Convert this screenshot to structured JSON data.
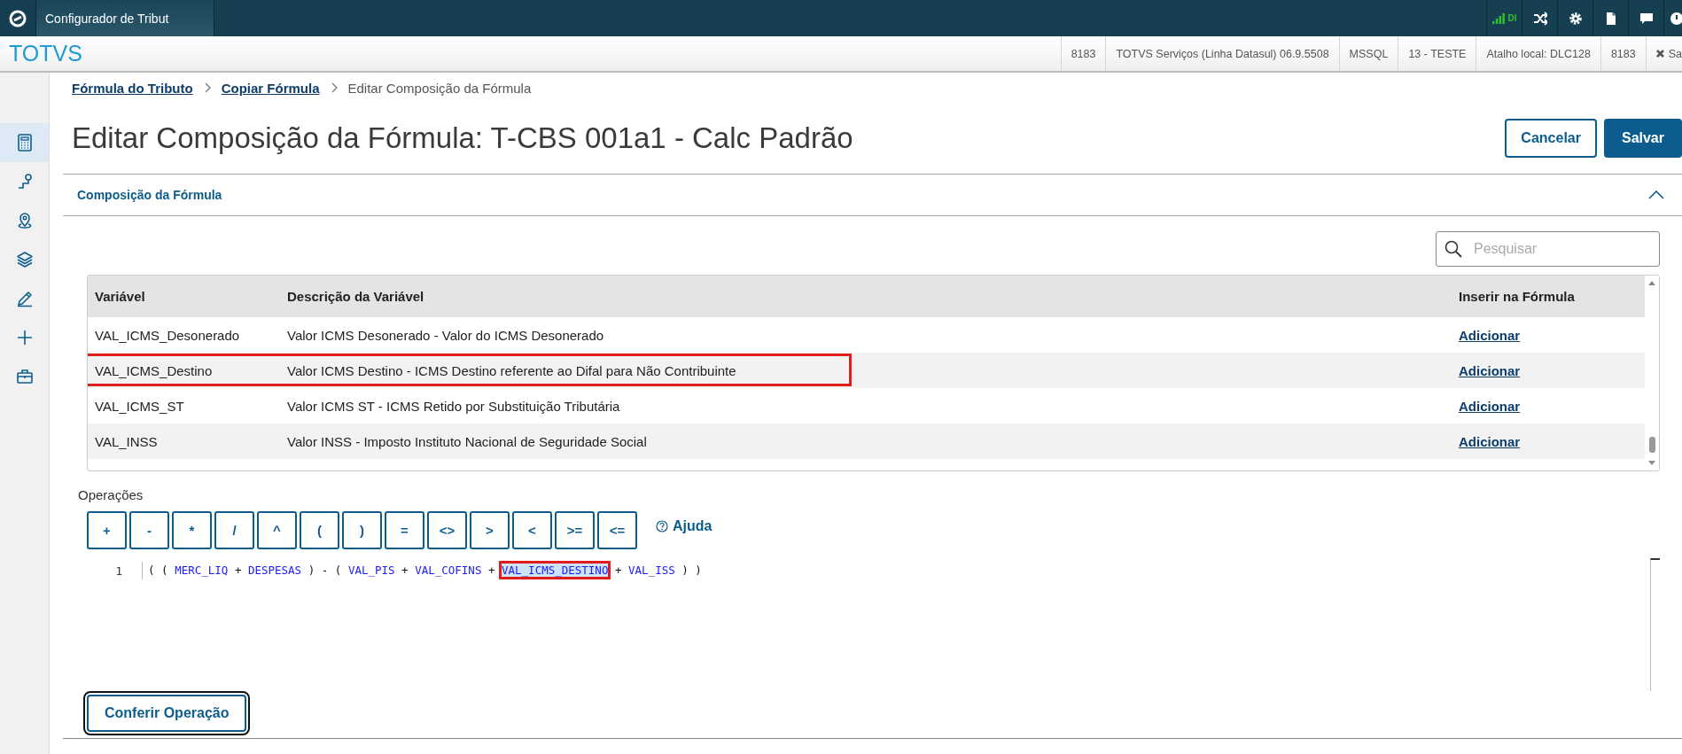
{
  "app_bar": {
    "tabs": [
      {
        "label": "Configurador de Tribut",
        "selected": true
      }
    ],
    "signal_label": "DI"
  },
  "header": {
    "brand": "TOTVS",
    "info": [
      "8183",
      "TOTVS Serviços (Linha Datasul) 06.9.5508",
      "MSSQL",
      "13 - TESTE",
      "Atalho local: DLC128",
      "8183"
    ],
    "exit_label": "Sa"
  },
  "sidebar": {
    "items": [
      {
        "kind": "calculator",
        "selected": true
      },
      {
        "kind": "route",
        "selected": false
      },
      {
        "kind": "pin",
        "selected": false
      },
      {
        "kind": "layers",
        "selected": false
      },
      {
        "kind": "pencil",
        "selected": false
      },
      {
        "kind": "plus",
        "selected": false
      },
      {
        "kind": "briefcase",
        "selected": false
      }
    ]
  },
  "breadcrumb": [
    {
      "label": "Fórmula do Tributo",
      "kind": "link"
    },
    {
      "label": "Copiar Fórmula",
      "kind": "link"
    },
    {
      "label": "Editar Composição da Fórmula",
      "kind": "current"
    }
  ],
  "title": "Editar Composição da Fórmula: T-CBS 001a1 - Calc Padrão",
  "actions": [
    {
      "label": "Cancelar",
      "kind": "secondary"
    },
    {
      "label": "Salvar",
      "kind": "primary"
    }
  ],
  "section": {
    "title": "Composição da Fórmula",
    "expanded": true
  },
  "search": {
    "placeholder": "Pesquisar"
  },
  "table": {
    "columns": [
      "Variável",
      "Descrição da Variável",
      "Inserir na Fórmula"
    ],
    "rows": [
      {
        "variable": "VAL_ICMS_Desonerado",
        "description": "Valor ICMS Desonerado - Valor do ICMS Desonerado",
        "action": "Adicionar",
        "highlighted": false
      },
      {
        "variable": "VAL_ICMS_Destino",
        "description": "Valor ICMS Destino - ICMS Destino referente ao Difal para Não Contribuinte",
        "action": "Adicionar",
        "highlighted": true
      },
      {
        "variable": "VAL_ICMS_ST",
        "description": "Valor ICMS ST - ICMS Retido por Substituição Tributária",
        "action": "Adicionar",
        "highlighted": false
      },
      {
        "variable": "VAL_INSS",
        "description": "Valor INSS - Imposto Instituto Nacional de Seguridade Social",
        "action": "Adicionar",
        "highlighted": false
      }
    ]
  },
  "operations": {
    "label": "Operações",
    "buttons": [
      "+",
      "-",
      "*",
      "/",
      "^",
      "(",
      ")",
      "=",
      "<>",
      ">",
      "<",
      ">=",
      "<="
    ],
    "help": "Ajuda"
  },
  "editor": {
    "lines": [
      {
        "number": "1",
        "tokens": [
          {
            "text": "(",
            "kind": "op",
            "highlighted": false
          },
          {
            "text": "(",
            "kind": "op",
            "highlighted": false
          },
          {
            "text": "MERC_LIQ",
            "kind": "var",
            "highlighted": false
          },
          {
            "text": "+",
            "kind": "op",
            "highlighted": false
          },
          {
            "text": "DESPESAS",
            "kind": "var",
            "highlighted": false
          },
          {
            "text": ")",
            "kind": "op",
            "highlighted": false
          },
          {
            "text": "-",
            "kind": "op",
            "highlighted": false
          },
          {
            "text": "(",
            "kind": "op",
            "highlighted": false
          },
          {
            "text": "VAL_PIS",
            "kind": "var",
            "highlighted": false
          },
          {
            "text": "+",
            "kind": "op",
            "highlighted": false
          },
          {
            "text": "VAL_COFINS",
            "kind": "var",
            "highlighted": false
          },
          {
            "text": "+",
            "kind": "op",
            "highlighted": false
          },
          {
            "text": "VAL_ICMS_DESTINO",
            "kind": "var",
            "highlighted": true
          },
          {
            "text": "+",
            "kind": "op",
            "highlighted": false
          },
          {
            "text": "VAL_ISS",
            "kind": "var",
            "highlighted": false
          },
          {
            "text": ")",
            "kind": "op",
            "highlighted": false
          },
          {
            "text": ")",
            "kind": "op",
            "highlighted": false
          }
        ]
      }
    ]
  },
  "check_button": {
    "label": "Conferir Operação"
  }
}
